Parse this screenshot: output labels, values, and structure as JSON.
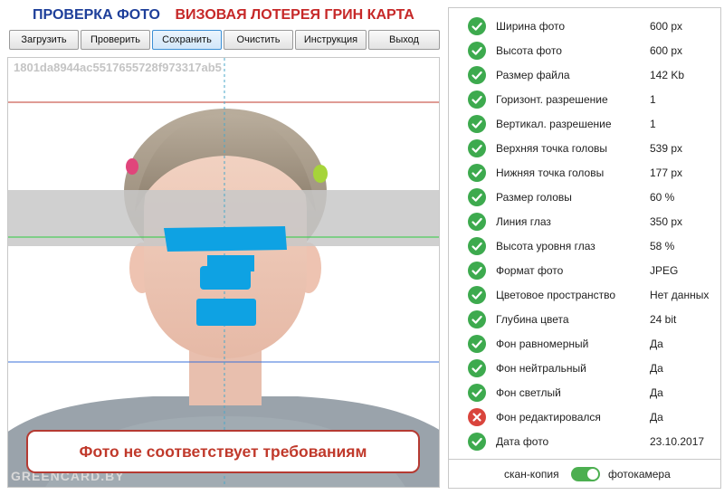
{
  "header": {
    "title_left": "ПРОВЕРКА ФОТО",
    "title_right": "ВИЗОВАЯ ЛОТЕРЕЯ ГРИН КАРТА"
  },
  "toolbar": {
    "buttons": [
      "Загрузить",
      "Проверить",
      "Сохранить",
      "Очистить",
      "Инструкция",
      "Выход"
    ],
    "active": "Сохранить"
  },
  "photo": {
    "file_hash": "1801da8944ac5517655728f973317ab5",
    "watermark": "GREENCARD.BY"
  },
  "warning": "Фото не соответствует требованиям",
  "checks": [
    {
      "label": "Ширина фото",
      "value": "600 px",
      "status": "ok"
    },
    {
      "label": "Высота фото",
      "value": "600 px",
      "status": "ok"
    },
    {
      "label": "Размер файла",
      "value": "142 Kb",
      "status": "ok"
    },
    {
      "label": "Горизонт. разрешение",
      "value": "1",
      "status": "ok"
    },
    {
      "label": "Вертикал. разрешение",
      "value": "1",
      "status": "ok"
    },
    {
      "label": "Верхняя точка головы",
      "value": "539 px",
      "status": "ok"
    },
    {
      "label": "Нижняя точка головы",
      "value": "177 px",
      "status": "ok"
    },
    {
      "label": "Размер головы",
      "value": "60 %",
      "status": "ok"
    },
    {
      "label": "Линия глаз",
      "value": "350 px",
      "status": "ok"
    },
    {
      "label": "Высота уровня глаз",
      "value": "58 %",
      "status": "ok"
    },
    {
      "label": "Формат фото",
      "value": "JPEG",
      "status": "ok"
    },
    {
      "label": "Цветовое пространство",
      "value": "Нет данных",
      "status": "ok"
    },
    {
      "label": "Глубина цвета",
      "value": "24 bit",
      "status": "ok"
    },
    {
      "label": "Фон равномерный",
      "value": "Да",
      "status": "ok"
    },
    {
      "label": "Фон нейтральный",
      "value": "Да",
      "status": "ok"
    },
    {
      "label": "Фон светлый",
      "value": "Да",
      "status": "ok"
    },
    {
      "label": "Фон редактировался",
      "value": "Да",
      "status": "fail"
    },
    {
      "label": "Дата фото",
      "value": "23.10.2017",
      "status": "ok"
    }
  ],
  "mode": {
    "left": "скан-копия",
    "right": "фотокамера",
    "on": "right"
  },
  "colors": {
    "ok": "#3daa4e",
    "fail": "#d9443c",
    "accent": "#3c8fd4",
    "brand_blue": "#1e3f9a",
    "brand_red": "#c62828"
  },
  "icons": {
    "ok": "check-circle-icon",
    "fail": "cross-circle-icon"
  }
}
